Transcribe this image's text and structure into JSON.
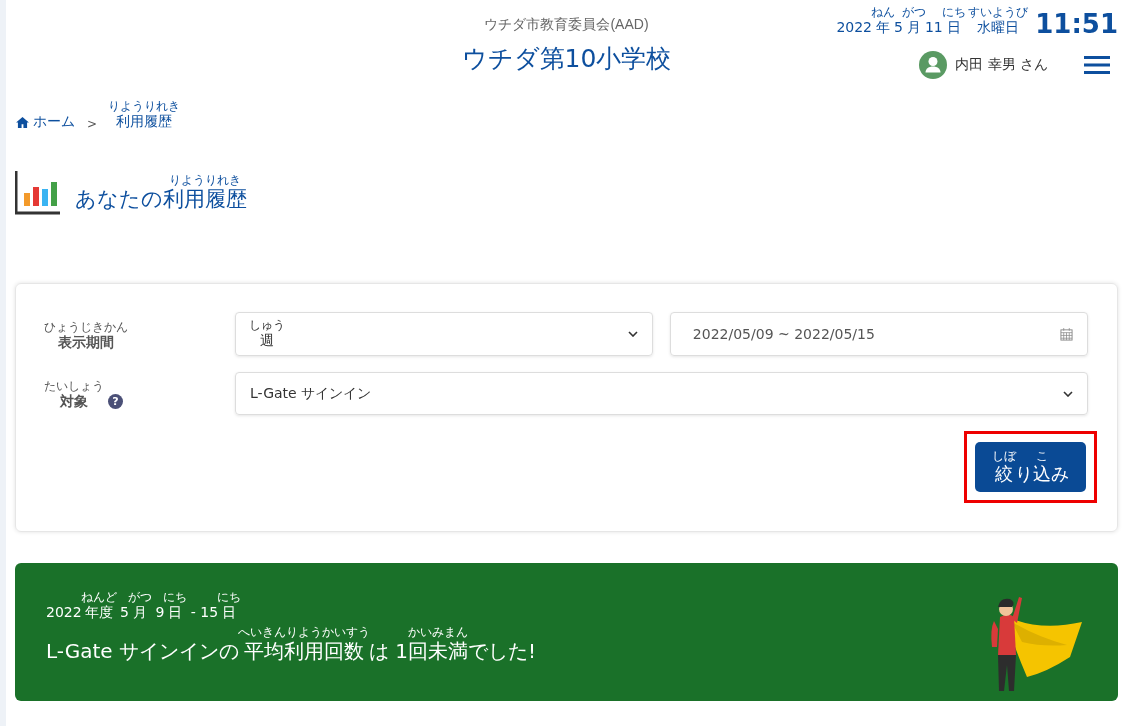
{
  "header": {
    "organization": "ウチダ市教育委員会(AAD)",
    "school": "ウチダ第10小学校",
    "date": {
      "segments": [
        {
          "text": "2022",
          "kind": "plain"
        },
        {
          "text": "年",
          "kind": "annotated"
        },
        {
          "text": "5",
          "kind": "plain"
        },
        {
          "text": "月",
          "kind": "annotated"
        },
        {
          "text": "11",
          "kind": "plain"
        },
        {
          "text": "日",
          "kind": "annotated"
        },
        {
          "text": " 水曜日",
          "kind": "annotated"
        }
      ],
      "furigana": [
        "ねん",
        "がつ",
        "にち",
        "すいようび"
      ]
    },
    "time": "11:51",
    "user": "内田 幸男 さん"
  },
  "breadcrumb": {
    "home": "ホーム",
    "separator": ">",
    "current": {
      "segments": [
        {
          "text": "利用履歴",
          "kind": "annotated"
        }
      ],
      "furigana": [
        "りようりれき"
      ]
    }
  },
  "page_title": {
    "segments": [
      {
        "text": "あなたの",
        "kind": "plain"
      },
      {
        "text": "利用履歴",
        "kind": "annotated"
      }
    ],
    "furigana": [
      "りようりれき"
    ]
  },
  "filter": {
    "period": {
      "label": {
        "segments": [
          {
            "text": "表示期間",
            "kind": "annotated"
          }
        ],
        "furigana": [
          "ひょうじきかん"
        ]
      },
      "value": {
        "segments": [
          {
            "text": "週",
            "kind": "annotated"
          }
        ],
        "furigana": [
          "しゅう"
        ]
      },
      "range": "2022/05/09 ~ 2022/05/15"
    },
    "target": {
      "label": {
        "segments": [
          {
            "text": "対象",
            "kind": "annotated"
          }
        ],
        "furigana": [
          "たいしょう"
        ]
      },
      "help": "?",
      "value": "L-Gate サインイン"
    },
    "button": {
      "label": {
        "segments": [
          {
            "text": "絞",
            "kind": "annotated"
          },
          {
            "text": "り",
            "kind": "plain"
          },
          {
            "text": "込",
            "kind": "annotated"
          },
          {
            "text": "み",
            "kind": "plain"
          }
        ],
        "furigana": [
          "しぼ",
          "こ"
        ]
      },
      "highlighted": true
    }
  },
  "result": {
    "period": {
      "segments": [
        {
          "text": "2022",
          "kind": "plain"
        },
        {
          "text": "年度",
          "kind": "annotated"
        },
        {
          "text": " 5",
          "kind": "plain"
        },
        {
          "text": "月",
          "kind": "annotated"
        },
        {
          "text": " 9",
          "kind": "plain"
        },
        {
          "text": "日",
          "kind": "annotated"
        },
        {
          "text": " - 15",
          "kind": "plain"
        },
        {
          "text": "日",
          "kind": "annotated"
        }
      ],
      "furigana": [
        "ねんど",
        "がつ",
        "にち",
        "にち"
      ]
    },
    "message": {
      "segments": [
        {
          "text": "L-Gate サインインの",
          "kind": "plain"
        },
        {
          "text": "平均利用回数",
          "kind": "annotated"
        },
        {
          "text": "は 1",
          "kind": "plain"
        },
        {
          "text": "回未満",
          "kind": "annotated"
        },
        {
          "text": "でした!",
          "kind": "plain"
        }
      ],
      "furigana": [
        "へいきんりようかいすう",
        "かいみまん"
      ]
    }
  }
}
